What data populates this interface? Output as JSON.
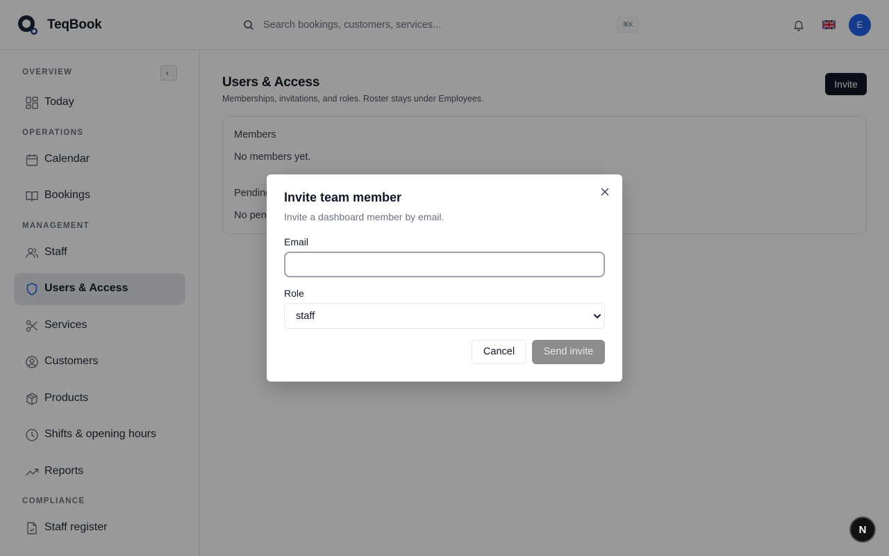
{
  "app": {
    "name": "TeqBook"
  },
  "search": {
    "placeholder": "Search bookings, customers, services...",
    "shortcut": "⌘K"
  },
  "header": {
    "avatar_initial": "E",
    "icons": [
      "bell-icon",
      "uk-flag-icon"
    ]
  },
  "sidebar": {
    "sections": [
      {
        "label": "OVERVIEW"
      },
      {
        "label": "OPERATIONS"
      },
      {
        "label": "MANAGEMENT"
      },
      {
        "label": "COMPLIANCE"
      }
    ],
    "items": [
      {
        "label": "Today",
        "icon": "dashboard-icon"
      },
      {
        "label": "Calendar",
        "icon": "calendar-icon"
      },
      {
        "label": "Bookings",
        "icon": "book-icon"
      },
      {
        "label": "Staff",
        "icon": "users-icon"
      },
      {
        "label": "Users & Access",
        "icon": "shield-icon",
        "active": true
      },
      {
        "label": "Services",
        "icon": "scissors-icon"
      },
      {
        "label": "Customers",
        "icon": "user-circle-icon"
      },
      {
        "label": "Products",
        "icon": "package-icon"
      },
      {
        "label": "Shifts & opening hours",
        "icon": "clock-icon"
      },
      {
        "label": "Reports",
        "icon": "trend-icon"
      },
      {
        "label": "Staff register",
        "icon": "file-check-icon"
      }
    ]
  },
  "main": {
    "title": "Users & Access",
    "subtitle": "Memberships, invitations, and roles. Roster stays under Employees.",
    "invite_label": "Invite",
    "card": {
      "members_heading": "Members",
      "members_empty": "No members yet.",
      "pending_heading": "Pending",
      "pending_empty": "No pen"
    }
  },
  "modal": {
    "title": "Invite team member",
    "description": "Invite a dashboard member by email.",
    "email_label": "Email",
    "email_value": "",
    "role_label": "Role",
    "role_value": "staff",
    "cancel_label": "Cancel",
    "send_label": "Send invite"
  },
  "dev_badge": "N",
  "colors": {
    "accent": "#2563eb",
    "dark": "#111827",
    "overlay": "rgba(0,0,0,0.40)"
  }
}
